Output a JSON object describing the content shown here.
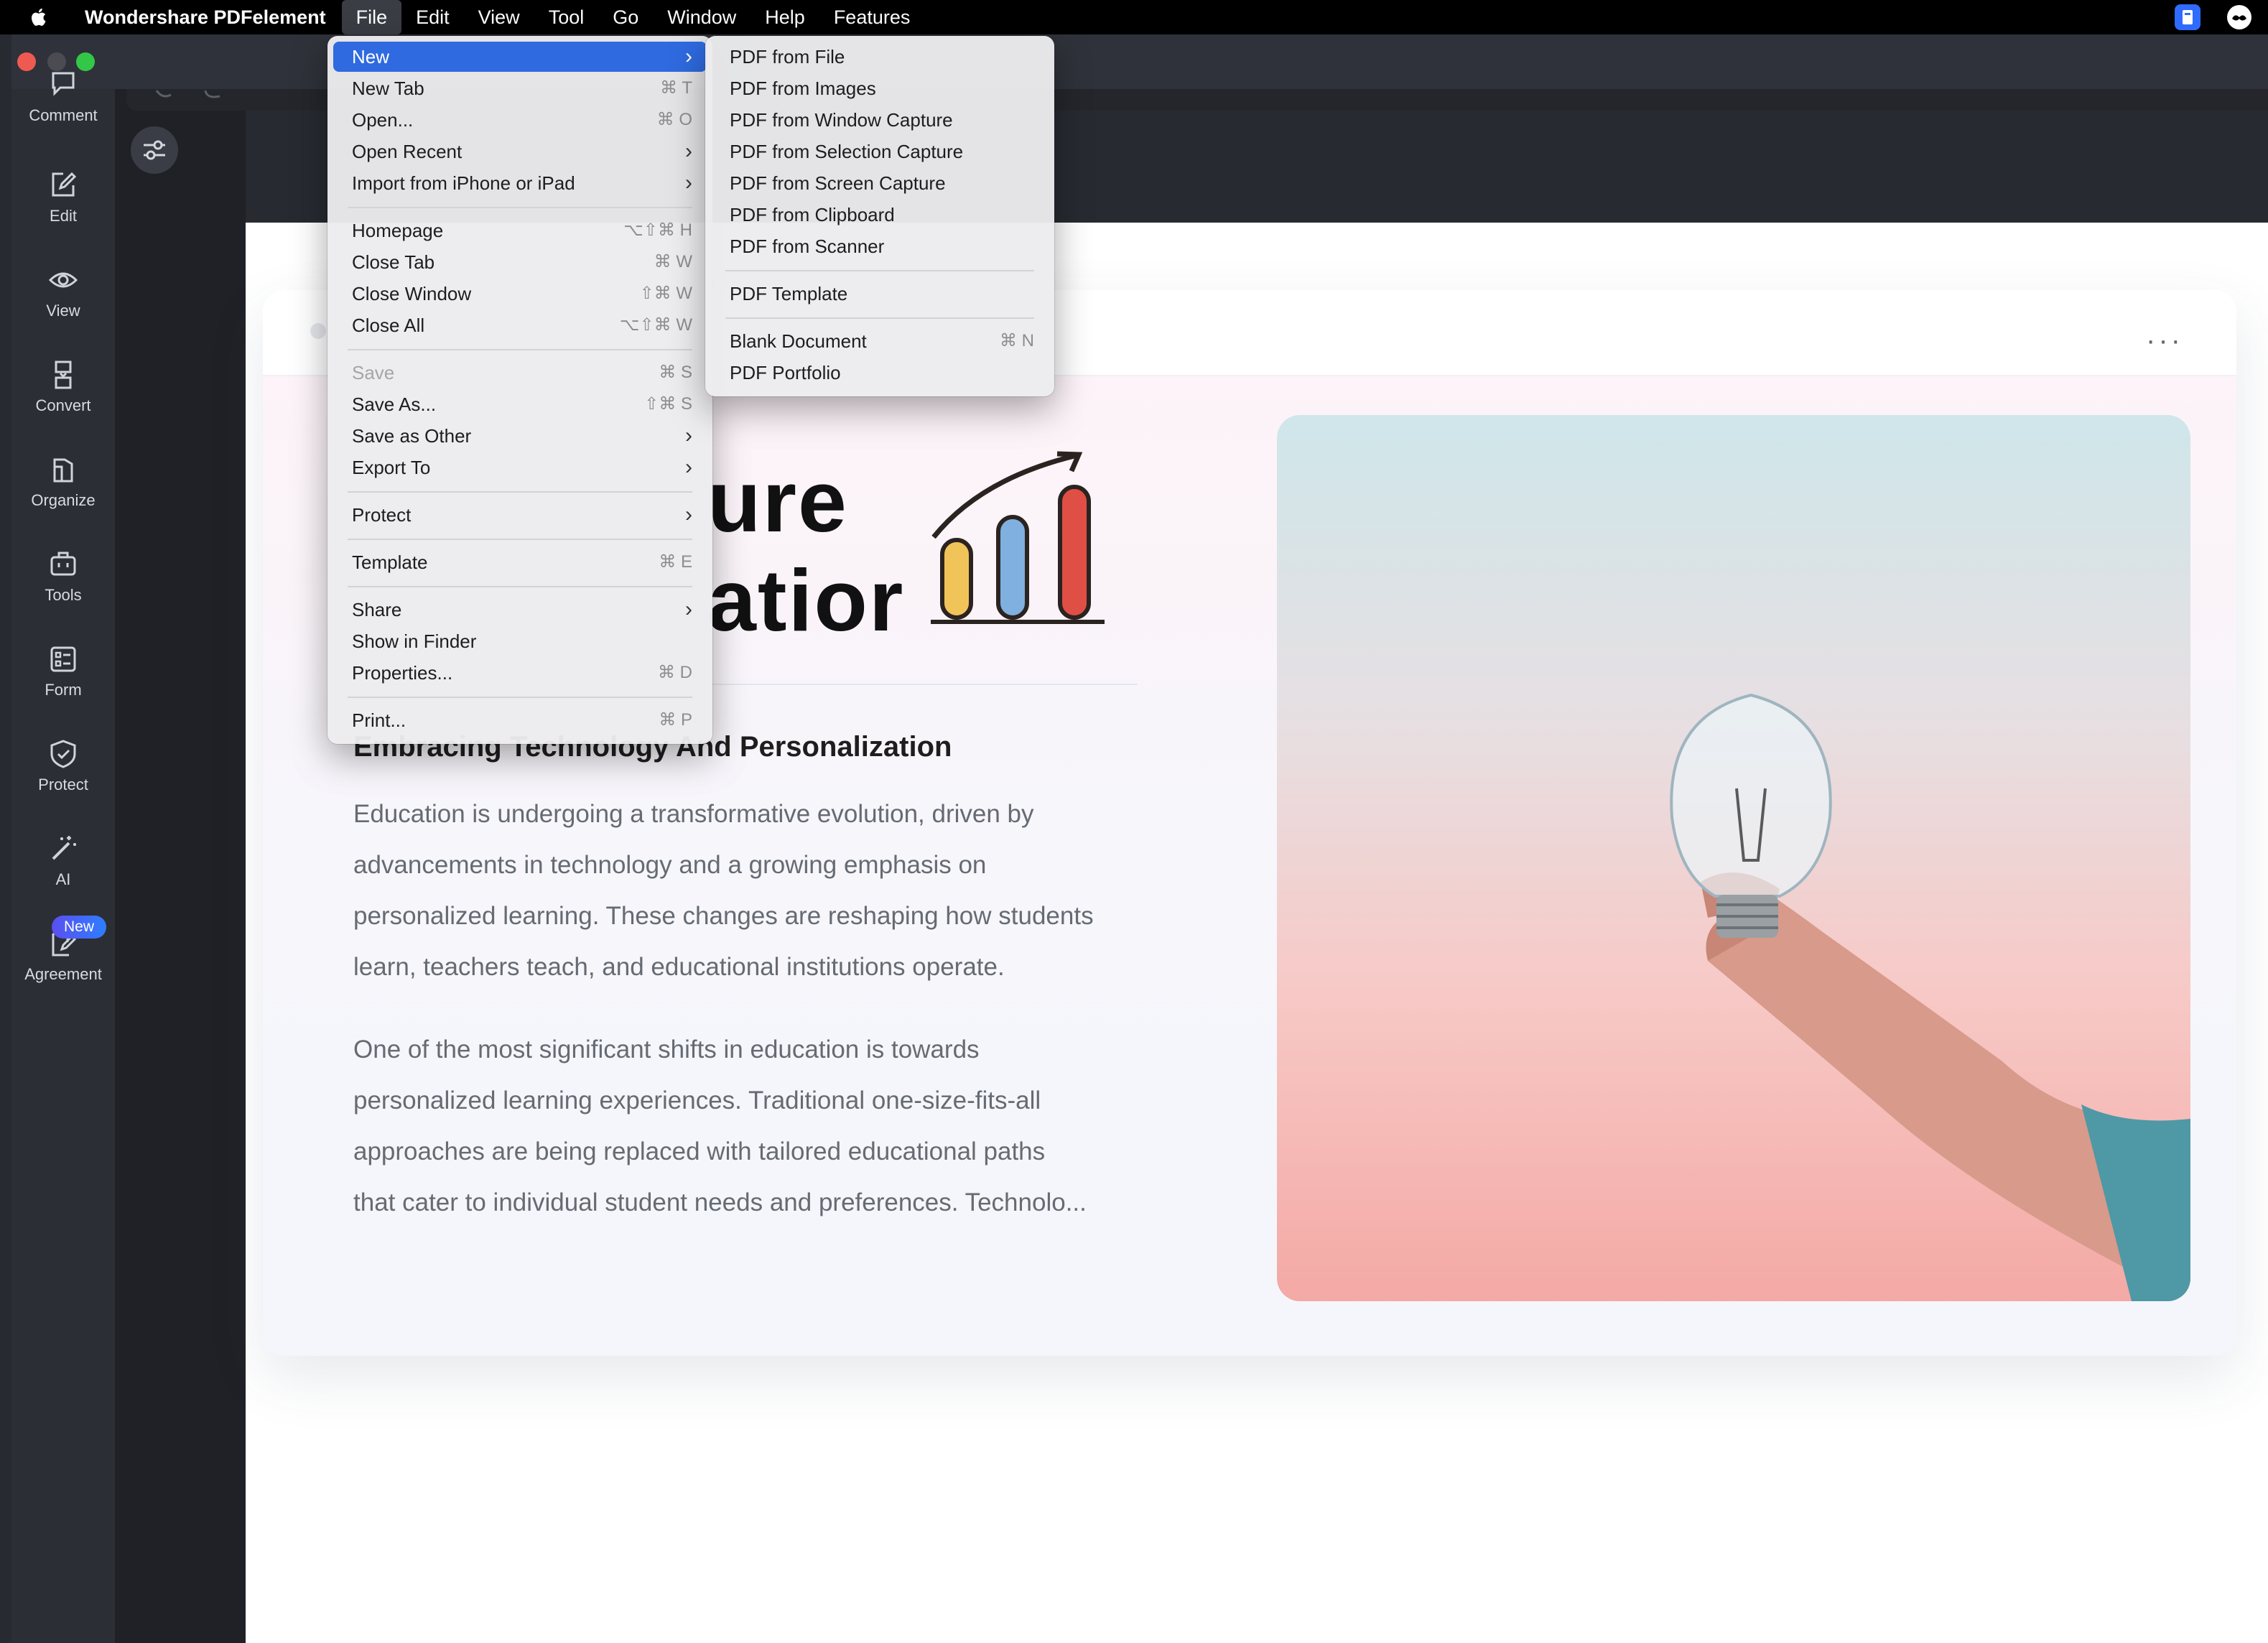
{
  "menubar": {
    "app_name": "Wondershare PDFelement",
    "items": [
      "File",
      "Edit",
      "View",
      "Tool",
      "Go",
      "Window",
      "Help",
      "Features"
    ]
  },
  "rail": {
    "items": [
      "Comment",
      "Edit",
      "View",
      "Convert",
      "Organize",
      "Tools",
      "Form",
      "Protect",
      "AI",
      "Agreement"
    ],
    "new_badge": "New"
  },
  "file_menu": {
    "items": [
      {
        "label": "New",
        "shortcut": ""
      },
      {
        "label": "New Tab",
        "shortcut": "⌘ T"
      },
      {
        "label": "Open...",
        "shortcut": "⌘ O"
      },
      {
        "label": "Open Recent",
        "shortcut": ""
      },
      {
        "label": "Import from iPhone or iPad",
        "shortcut": ""
      },
      {
        "label": "Homepage",
        "shortcut": "⌥⇧⌘ H"
      },
      {
        "label": "Close Tab",
        "shortcut": "⌘ W"
      },
      {
        "label": "Close Window",
        "shortcut": "⇧⌘ W"
      },
      {
        "label": "Close All",
        "shortcut": "⌥⇧⌘ W"
      },
      {
        "label": "Save",
        "shortcut": "⌘ S"
      },
      {
        "label": "Save As...",
        "shortcut": "⇧⌘ S"
      },
      {
        "label": "Save as Other",
        "shortcut": ""
      },
      {
        "label": "Export To",
        "shortcut": ""
      },
      {
        "label": "Protect",
        "shortcut": ""
      },
      {
        "label": "Template",
        "shortcut": "⌘ E"
      },
      {
        "label": "Share",
        "shortcut": ""
      },
      {
        "label": "Show in Finder",
        "shortcut": ""
      },
      {
        "label": "Properties...",
        "shortcut": "⌘ D"
      },
      {
        "label": "Print...",
        "shortcut": "⌘ P"
      }
    ]
  },
  "new_submenu": {
    "items": [
      {
        "label": "PDF from File",
        "shortcut": ""
      },
      {
        "label": "PDF from Images",
        "shortcut": ""
      },
      {
        "label": "PDF from Window Capture",
        "shortcut": ""
      },
      {
        "label": "PDF from Selection Capture",
        "shortcut": ""
      },
      {
        "label": "PDF from Screen Capture",
        "shortcut": ""
      },
      {
        "label": "PDF from Clipboard",
        "shortcut": ""
      },
      {
        "label": "PDF from Scanner",
        "shortcut": ""
      },
      {
        "label": "PDF Template",
        "shortcut": ""
      },
      {
        "label": "Blank Document",
        "shortcut": "⌘ N"
      },
      {
        "label": "PDF Portfolio",
        "shortcut": ""
      }
    ]
  },
  "document": {
    "title_line1": "ure",
    "title_line2": "atior",
    "subheading": "Embracing Technology And Personalization",
    "para1_lines": [
      "Education is undergoing a transformative evolution, driven by",
      "advancements in technology and a growing emphasis on",
      "personalized learning. These changes are reshaping how students",
      "learn, teachers teach, and educational institutions operate."
    ],
    "para2_lines": [
      "One of the most significant shifts in education is towards",
      "personalized learning experiences. Traditional one-size-fits-all",
      "approaches are being replaced with tailored educational paths",
      "that cater to individual student needs and preferences. Technolo..."
    ],
    "more_label": "···"
  },
  "colors": {
    "highlight": "#2f6ae0",
    "bar_yellow": "#f1c45a",
    "bar_blue": "#7fb0e0",
    "bar_red": "#df4f45"
  }
}
